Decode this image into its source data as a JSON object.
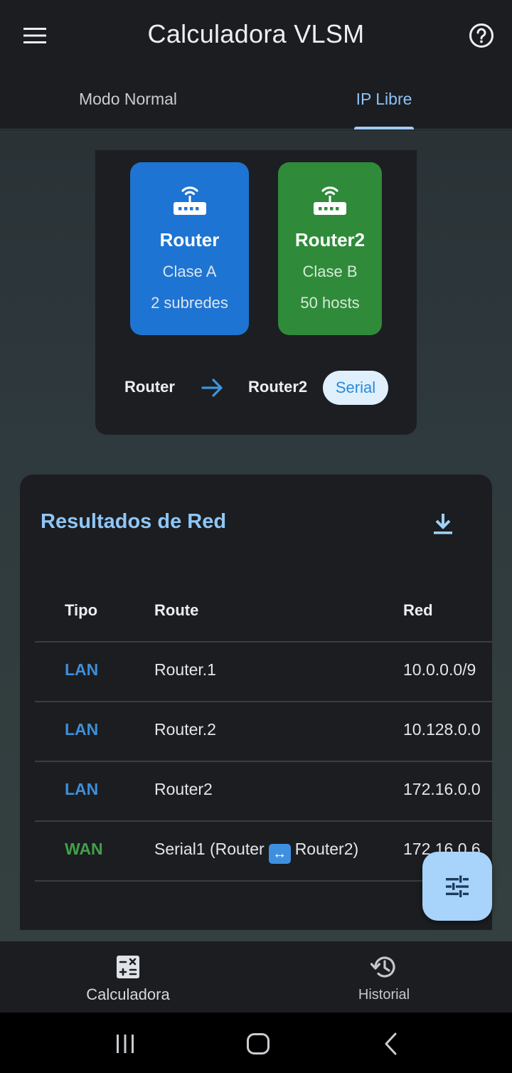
{
  "app": {
    "title": "Calculadora VLSM"
  },
  "tabs": [
    {
      "label": "Modo Normal"
    },
    {
      "label": "IP Libre",
      "selected": true
    }
  ],
  "topology": {
    "nodes": [
      {
        "name": "Router",
        "class": "Clase A",
        "detail": "2 subredes",
        "color": "#1e74d2",
        "icon": "router-icon"
      },
      {
        "name": "Router2",
        "class": "Clase B",
        "detail": "50 hosts",
        "color": "#2f8b3a",
        "icon": "router-icon"
      }
    ],
    "link": {
      "from": "Router",
      "to": "Router2",
      "type": "Serial",
      "icon": "arrow-right-icon"
    }
  },
  "results": {
    "title": "Resultados de Red",
    "download_icon": "download-icon",
    "columns": [
      "Tipo",
      "Route",
      "Red"
    ],
    "rows": [
      {
        "tipo": "LAN",
        "route": "Router.1",
        "red": "10.0.0.0/9"
      },
      {
        "tipo": "LAN",
        "route": "Router.2",
        "red": "10.128.0.0"
      },
      {
        "tipo": "LAN",
        "route": "Router2",
        "red": "172.16.0.0"
      },
      {
        "tipo": "WAN",
        "route_pre": "Serial1 (Router",
        "route_post": "Router2)",
        "red": "172.16.0.6"
      }
    ]
  },
  "fab": {
    "icon": "tune-icon"
  },
  "bottom_nav": [
    {
      "label": "Calculadora",
      "icon": "calculator-icon",
      "active": true
    },
    {
      "label": "Historial",
      "icon": "history-icon"
    }
  ],
  "colors": {
    "accent": "#8fc6f6",
    "lan": "#3e8ed8",
    "wan": "#41a148",
    "background": "#1b1d21"
  }
}
